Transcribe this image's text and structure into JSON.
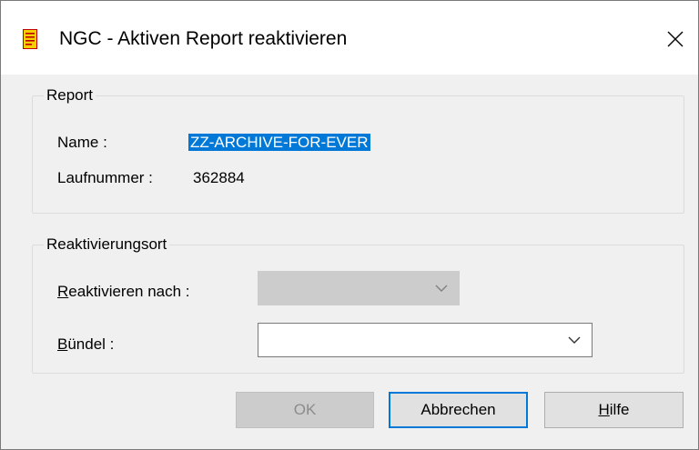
{
  "window": {
    "title": "NGC - Aktiven Report reaktivieren",
    "icon": "report-app-icon",
    "close_icon": "close-icon"
  },
  "report_group": {
    "label": "Report",
    "name_label": "Name :",
    "name_value": "ZZ-ARCHIVE-FOR-EVER",
    "number_label": "Laufnummer :",
    "number_value": "362884"
  },
  "location_group": {
    "label": "Reaktivierungsort",
    "reactivate_label_first": "R",
    "reactivate_label_rest": "eaktivieren nach :",
    "reactivate_value": "",
    "bundle_label_first": "B",
    "bundle_label_rest": "ündel :",
    "bundle_value": ""
  },
  "buttons": {
    "ok": "OK",
    "cancel": "Abbrechen",
    "help_first": "H",
    "help_rest": "ilfe"
  },
  "colors": {
    "selection": "#0078d7",
    "disabled": "#cccccc",
    "dialog_bg": "#f0f0f0"
  }
}
